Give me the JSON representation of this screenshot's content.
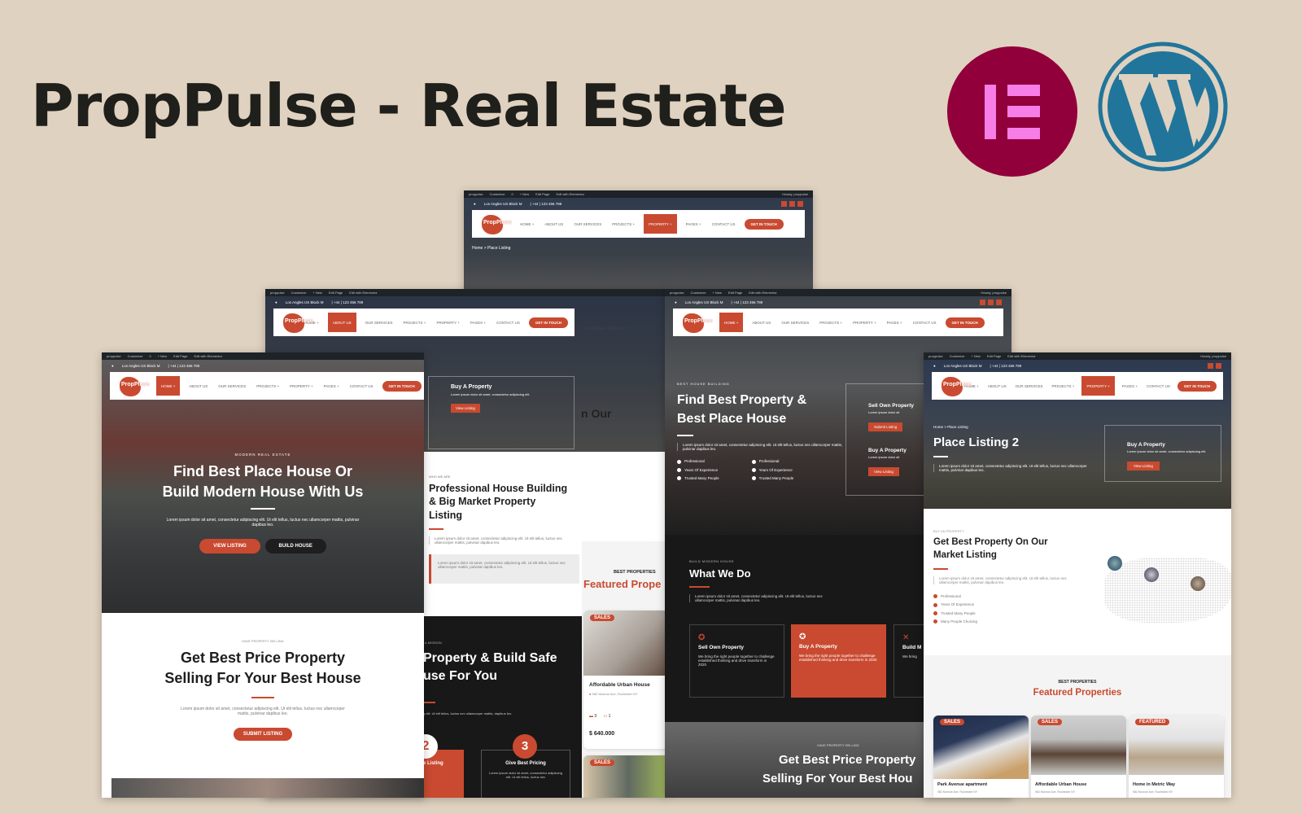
{
  "page": {
    "title": "PropPulse - Real Estate",
    "brand_logos": [
      "elementor-logo",
      "wordpress-logo"
    ],
    "colors": {
      "accent": "#c94a30",
      "background": "#e0d2c0",
      "elementor": "#92003b",
      "elementor_glyph": "#f67ee6",
      "wordpress": "#21759b",
      "dark": "#181818"
    }
  },
  "common": {
    "adminbar": [
      "proppulse",
      "Customize",
      "0",
      "+ New",
      "Edit Page",
      "Edit with Elementor"
    ],
    "howdy": "Howdy, proppulse",
    "address": "Los Angles US Block M",
    "phone": "| +44 | 123 456 789",
    "logo_line1": "PropPluse",
    "logo_line2": "Real Estate",
    "nav": [
      "HOME +",
      "ABOUT US",
      "OUR SERVICES",
      "PROJECTS +",
      "PROPERTY +",
      "PAGES +",
      "CONTACT US"
    ],
    "cta": "GET IN TOUCH"
  },
  "screen_home1": {
    "eyebrow": "MODERN REAL ESTATE",
    "heading_line1": "Find Best Place House Or",
    "heading_line2": "Build Modern House With Us",
    "lorem": "Lorem ipsum dolor sit amet, consectetur adipiscing elit. Ut elit tellus, luctus nec ullamcorper mattis, pulvinar dapibus leo.",
    "btn_view": "VIEW LISTING",
    "btn_build": "BUILD HOUSE",
    "sell_eyebrow": "HAVE PROPERTY SELLING",
    "sell_line1": "Get Best Price Property",
    "sell_line2": "Selling For Your Best House",
    "sell_lorem": "Lorem ipsum dolor sit amet, consectetur adipiscing elit. Ut elit tellus, luctus nec ullamcorper mattis, pulvinar dapibus leo.",
    "btn_submit": "SUBMIT LISTING"
  },
  "screen_about": {
    "buy_title": "Buy A Property",
    "buy_text": "Lorem ipsum dolor sit amet, consectetur adipiscing elit.",
    "buy_btn": "View Listing",
    "partial_text": "Ut elit tellus, luctus nec",
    "partial_heading": "n Our",
    "who_eyebrow": "WHO WE ARE",
    "who_line1": "Professional House Building",
    "who_line2": "& Big Market Property",
    "who_line3": "Listing",
    "who_lorem": "Lorem ipsum dolor sit amet, consectetur adipiscing elit. Ut elit tellus, luctus nec ullamcorper mattis, pulvinar dapibus leo.",
    "quote": "Lorem ipsum dolor sit amet, consectetur adipiscing elit. Ut elit tellus, luctus nec ullamcorper mattis, pulvinar dapibus leo.",
    "mission_eyebrow": "& MISSION",
    "mission_line1": "Property & Build Safe",
    "mission_line2": "use For You",
    "mission_text": "g elit. Ut elit tellus, luctus nec ullamcorper mattis, dapibus leo.",
    "step2": "2",
    "step3": "3",
    "step2_title": "e Listing",
    "step3_title": "Give Best Pricing",
    "step_text": "Lorem ipsum dolor sit amet, consectetur adipiscing elit. Ut elit tellus, luctus nec"
  },
  "screen_listing_top": {
    "breadcrumb_home": "Home",
    "breadcrumb_current": "Place Listing"
  },
  "featured_partial": {
    "eyebrow": "BEST PROPERTIES",
    "heading": "Featured Prope",
    "card": {
      "badge": "SALES",
      "title": "Affordable Urban House",
      "address": "982 Monroe Ave, Rochester NY",
      "beds": "3",
      "baths": "1",
      "price": "$ 640.000"
    },
    "card2_badge": "SALES"
  },
  "screen_home2": {
    "eyebrow": "BEST HOUSE BUILDING",
    "heading_line1": "Find Best Property &",
    "heading_line2": "Best Place House",
    "lorem": "Lorem ipsum dolor sit amet, consectetur adipiscing elit. Ut elit tellus, luctus nec ullamcorper mattis, pulvinar dapibus leo.",
    "checks_left": [
      "Professional",
      "Years Of Experience",
      "Trusted Many People"
    ],
    "checks_right": [
      "Professional",
      "Years Of Experience",
      "Trusted Many People"
    ],
    "side_cards": [
      {
        "title": "Sell Own Property",
        "text": "Lorem ipsum dolor sit",
        "btn": "Submit Listing"
      },
      {
        "title": "Buy A Property",
        "text": "Lorem ipsum dolor sit",
        "btn": "View Listing"
      }
    ],
    "wwd_eyebrow": "BUILD MODERN HOUSE",
    "wwd_heading": "What We Do",
    "wwd_lorem": "Lorem ipsum dolor sit amet, consectetur adipiscing elit. Ut elit tellus, luctus nec ullamcorper mattis, pulvinar dapibus leo.",
    "services": [
      {
        "title": "Sell Own Property",
        "text": "We bring the right people together to challenge established thinking and drive transform in 2020"
      },
      {
        "title": "Buy A Property",
        "text": "We bring the right people together to challenge established thinking and drive transform in 2020"
      },
      {
        "title": "Build M",
        "text": "We bring"
      }
    ],
    "sell_eyebrow": "HAVE PROPERTY SELLING",
    "sell_line1": "Get Best Price Property",
    "sell_line2": "Selling For Your Best Hou"
  },
  "screen_listing2": {
    "breadcrumb_home": "Home",
    "breadcrumb_current": "Place Listing",
    "heading": "Place Listing 2",
    "lorem": "Lorem ipsum dolor sit amet, consectetur adipiscing elit. Ut elit tellus, luctus nec ullamcorper mattis, pulvinar dapibus leo.",
    "buy_title": "Buy A Property",
    "buy_text": "Lorem ipsum dolor sit amet, consectetur adipiscing elit.",
    "buy_btn": "View Listing",
    "market_eyebrow": "BUY AN PROPERTY",
    "market_line1": "Get Best Property On Our",
    "market_line2": "Market Listing",
    "market_lorem": "Lorem ipsum dolor sit amet, consectetur adipiscing elit. Ut elit tellus, luctus nec ullamcorper mattis, pulvinar dapibus leo.",
    "market_checks": [
      "Professional",
      "Years Of Experience",
      "Trusted Many People",
      "Many People Choicing"
    ],
    "featured_eyebrow": "BEST PROPERTIES",
    "featured_heading": "Featured Properties",
    "cards": [
      {
        "badge": "SALES",
        "title": "Park Avenue apartment",
        "address": "982 Monroe Ave, Rochester NY"
      },
      {
        "badge": "SALES",
        "title": "Affordable Urban House",
        "address": "982 Monroe Ave, Rochester NY"
      },
      {
        "badge": "FEATURED",
        "title": "Home in Metric Way",
        "address": "982 Monroe Ave, Rochester NY"
      }
    ]
  }
}
